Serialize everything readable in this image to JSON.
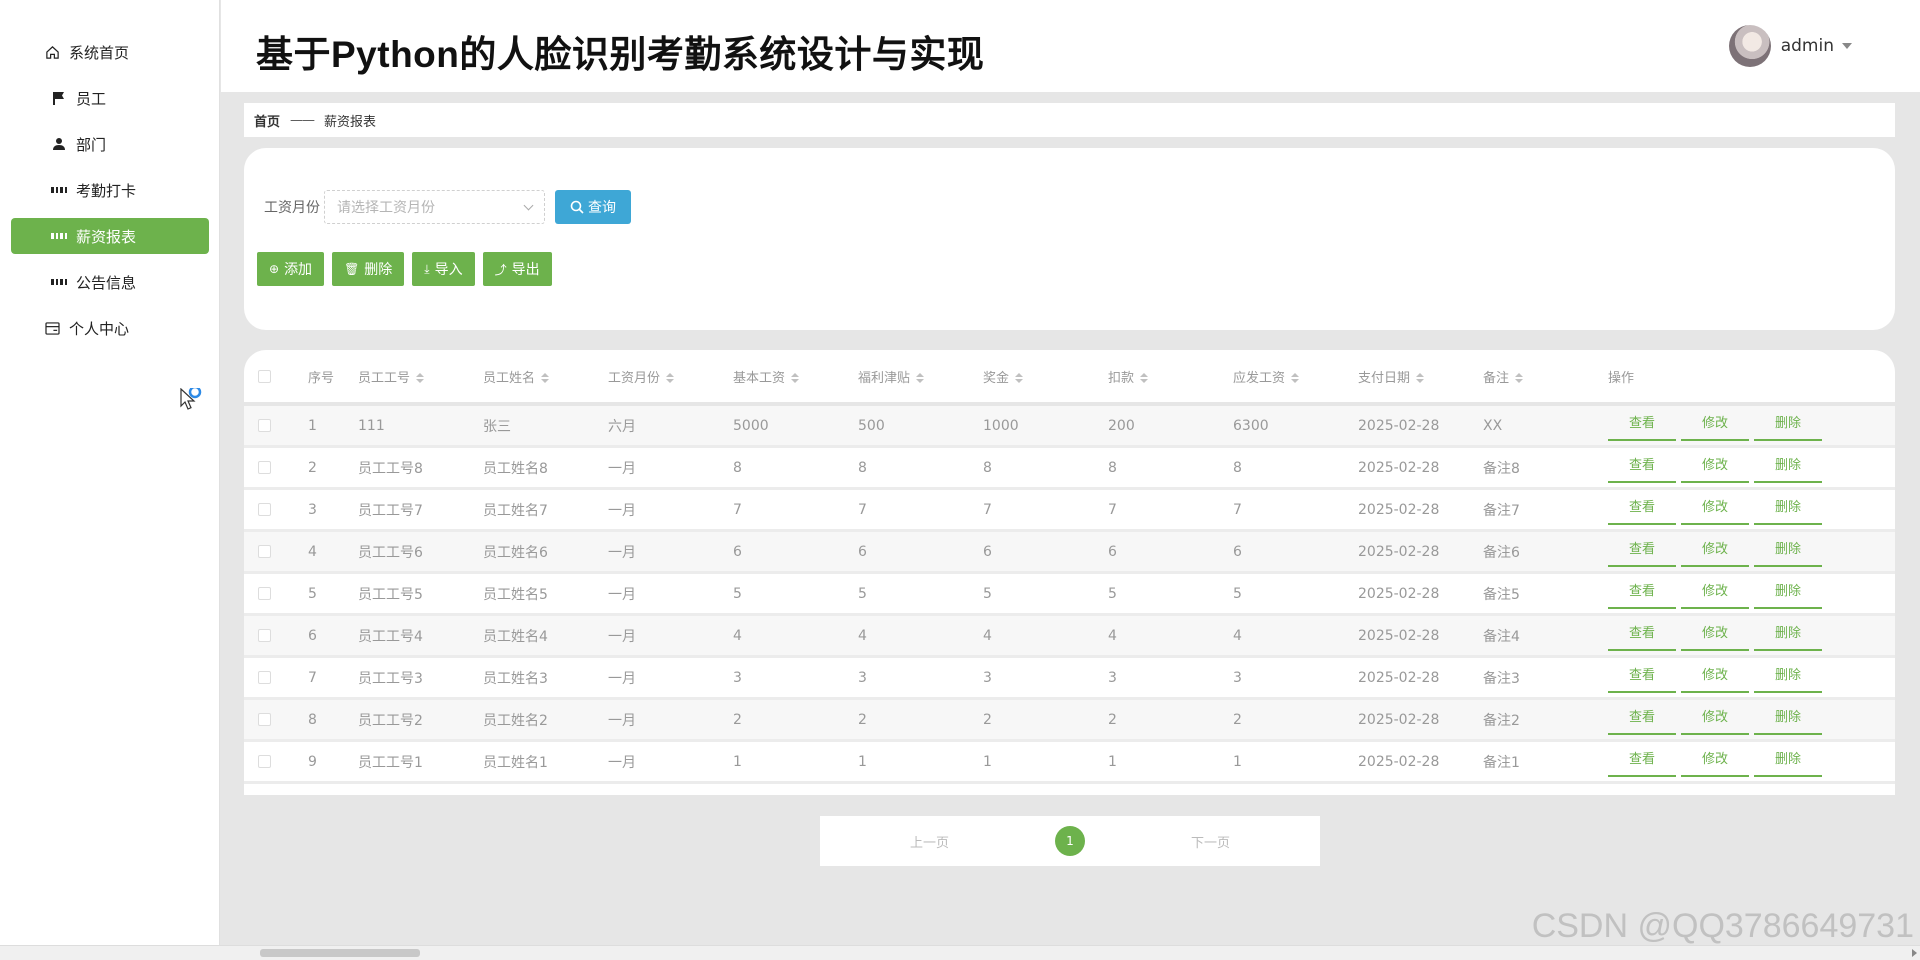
{
  "app": {
    "title": "基于Python的人脸识别考勤系统设计与实现"
  },
  "user": {
    "name": "admin"
  },
  "sidebar": {
    "items": [
      {
        "label": "系统首页",
        "icon": "home-icon"
      },
      {
        "label": "员工",
        "icon": "flag-icon"
      },
      {
        "label": "部门",
        "icon": "user-icon"
      },
      {
        "label": "考勤打卡",
        "icon": "grid-icon"
      },
      {
        "label": "薪资报表",
        "icon": "grid-icon",
        "active": true
      },
      {
        "label": "公告信息",
        "icon": "grid-icon"
      },
      {
        "label": "个人中心",
        "icon": "card-icon"
      }
    ]
  },
  "breadcrumb": {
    "home": "首页",
    "separator": "——",
    "current": "薪资报表"
  },
  "search": {
    "label": "工资月份",
    "placeholder": "请选择工资月份",
    "query_label": "查询"
  },
  "actions": {
    "add": "添加",
    "delete": "删除",
    "import": "导入",
    "export": "导出"
  },
  "table": {
    "headers": {
      "no": "序号",
      "emp_id": "员工工号",
      "emp_name": "员工姓名",
      "month": "工资月份",
      "base": "基本工资",
      "welfare": "福利津贴",
      "bonus": "奖金",
      "deduction": "扣款",
      "payable": "应发工资",
      "pay_date": "支付日期",
      "remark": "备注",
      "ops": "操作"
    },
    "op_labels": {
      "view": "查看",
      "edit": "修改",
      "delete": "删除"
    },
    "rows": [
      [
        "1",
        "111",
        "张三",
        "六月",
        "5000",
        "500",
        "1000",
        "200",
        "6300",
        "2025-02-28",
        "XX"
      ],
      [
        "2",
        "员工工号8",
        "员工姓名8",
        "一月",
        "8",
        "8",
        "8",
        "8",
        "8",
        "2025-02-28",
        "备注8"
      ],
      [
        "3",
        "员工工号7",
        "员工姓名7",
        "一月",
        "7",
        "7",
        "7",
        "7",
        "7",
        "2025-02-28",
        "备注7"
      ],
      [
        "4",
        "员工工号6",
        "员工姓名6",
        "一月",
        "6",
        "6",
        "6",
        "6",
        "6",
        "2025-02-28",
        "备注6"
      ],
      [
        "5",
        "员工工号5",
        "员工姓名5",
        "一月",
        "5",
        "5",
        "5",
        "5",
        "5",
        "2025-02-28",
        "备注5"
      ],
      [
        "6",
        "员工工号4",
        "员工姓名4",
        "一月",
        "4",
        "4",
        "4",
        "4",
        "4",
        "2025-02-28",
        "备注4"
      ],
      [
        "7",
        "员工工号3",
        "员工姓名3",
        "一月",
        "3",
        "3",
        "3",
        "3",
        "3",
        "2025-02-28",
        "备注3"
      ],
      [
        "8",
        "员工工号2",
        "员工姓名2",
        "一月",
        "2",
        "2",
        "2",
        "2",
        "2",
        "2025-02-28",
        "备注2"
      ],
      [
        "9",
        "员工工号1",
        "员工姓名1",
        "一月",
        "1",
        "1",
        "1",
        "1",
        "1",
        "2025-02-28",
        "备注1"
      ]
    ]
  },
  "pagination": {
    "prev": "上一页",
    "current": "1",
    "next": "下一页"
  },
  "watermark": "CSDN @QQ3786649731",
  "colors": {
    "accent": "#6db24c",
    "query": "#3ea7d6"
  }
}
